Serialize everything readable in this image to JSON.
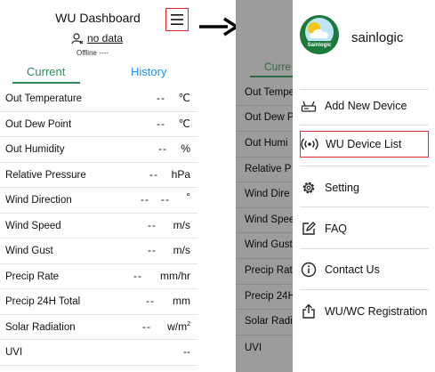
{
  "dashboard": {
    "title": "WU Dashboard",
    "user_status": "no data",
    "offline_text": "Offline ----",
    "tabs": {
      "current": "Current",
      "history": "History"
    },
    "rows": [
      {
        "label": "Out Temperature",
        "value": "--",
        "unit": "℃"
      },
      {
        "label": "Out Dew Point",
        "value": "--",
        "unit": "℃"
      },
      {
        "label": "Out Humidity",
        "value": "--",
        "unit": "%"
      },
      {
        "label": "Relative Pressure",
        "value": "--",
        "unit": "hPa"
      },
      {
        "label": "Wind Direction",
        "value": "--   --",
        "unit": "°"
      },
      {
        "label": "Wind Speed",
        "value": "--",
        "unit": "m/s"
      },
      {
        "label": "Wind Gust",
        "value": "--",
        "unit": "m/s"
      },
      {
        "label": "Precip Rate",
        "value": "--",
        "unit": "mm/hr"
      },
      {
        "label": "Precip 24H Total",
        "value": "--",
        "unit": "mm"
      },
      {
        "label": "Solar Radiation",
        "value": "--",
        "unit": "w/m",
        "unit_sup": "2"
      },
      {
        "label": "UVI",
        "value": "--",
        "unit": ""
      }
    ]
  },
  "dimmed_dashboard": {
    "tab": "Curre",
    "rows": [
      "Out Tempe",
      "Out Dew P",
      "Out Humi",
      "Relative P",
      "Wind Dire",
      "Wind Spee",
      "Wind Gust",
      "Precip Rat",
      "Precip 24H",
      "Solar Radi",
      "UVI"
    ]
  },
  "drawer": {
    "brand": "sainlogic",
    "logo_text": "Sainlogic",
    "items": [
      {
        "label": "Add New Device",
        "icon": "router-icon",
        "selected": false
      },
      {
        "label": "WU Device List",
        "icon": "broadcast-icon",
        "selected": true
      },
      {
        "label": "Setting",
        "icon": "gear-icon",
        "selected": false
      },
      {
        "label": "FAQ",
        "icon": "edit-icon",
        "selected": false
      },
      {
        "label": "Contact Us",
        "icon": "info-icon",
        "selected": false
      },
      {
        "label": "WU/WC Registration",
        "icon": "external-link-icon",
        "selected": false
      }
    ]
  },
  "colors": {
    "accent_green": "#2e8b57",
    "accent_blue": "#1e90ff",
    "highlight_red": "#e0262a",
    "overlay_gray": "#9c9c9c"
  }
}
